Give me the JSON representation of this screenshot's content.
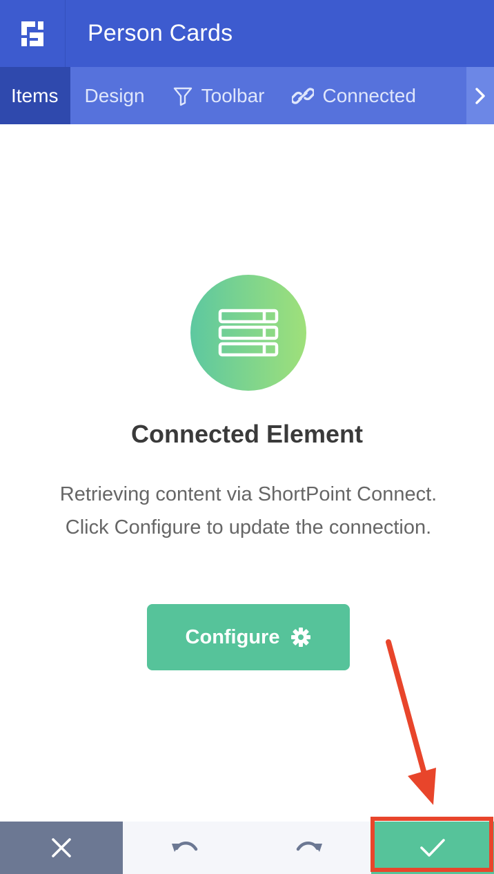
{
  "header": {
    "title": "Person Cards",
    "logo_icon": "shortpoint-logo-icon"
  },
  "tabs": [
    {
      "label": "Items",
      "icon": ""
    },
    {
      "label": "Design",
      "icon": ""
    },
    {
      "label": "Toolbar",
      "icon": "filter-icon"
    },
    {
      "label": "Connected",
      "icon": "link-icon"
    }
  ],
  "main": {
    "heading": "Connected Element",
    "description": "Retrieving content via ShortPoint Connect. Click Configure to update the connection.",
    "configure_label": "Configure",
    "icon": "server-list-icon"
  },
  "footer": {
    "close_icon": "close-icon",
    "undo_icon": "undo-icon",
    "redo_icon": "redo-icon",
    "confirm_icon": "checkmark-icon"
  },
  "colors": {
    "header": "#3d5bcf",
    "tabs": "#5672dc",
    "active_tab": "#2f49ad",
    "accent_green": "#56c39a",
    "annotation_red": "#e8452b"
  }
}
